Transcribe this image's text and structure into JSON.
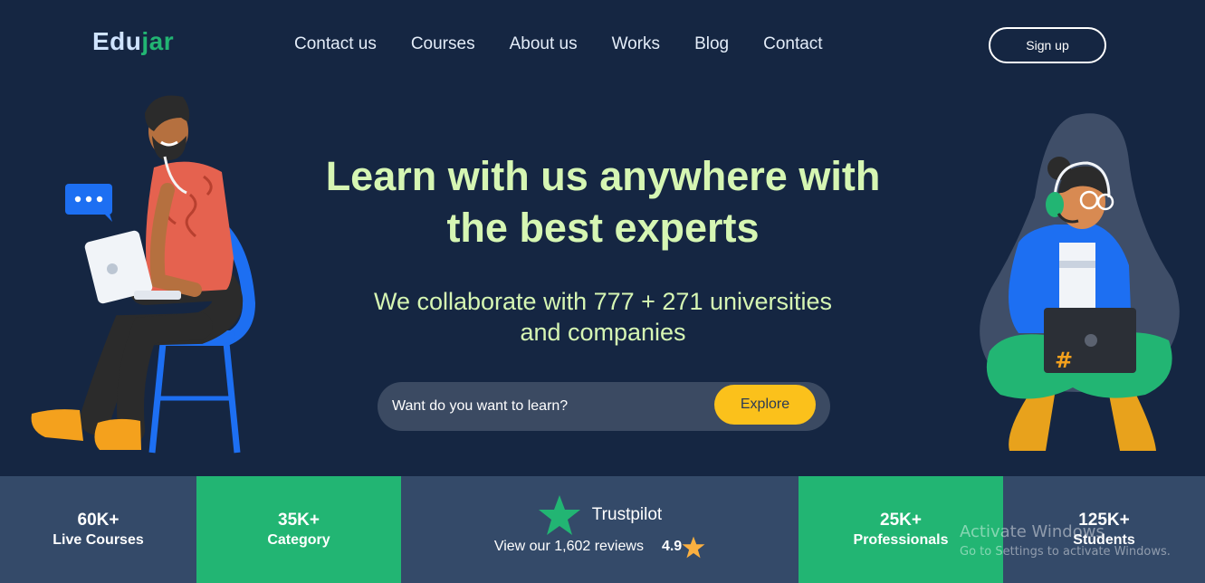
{
  "logo": {
    "part1": "Edu",
    "part2": "jar"
  },
  "nav": [
    {
      "label": "Contact us"
    },
    {
      "label": "Courses"
    },
    {
      "label": "About us"
    },
    {
      "label": "Works"
    },
    {
      "label": "Blog"
    },
    {
      "label": "Contact"
    }
  ],
  "signup_label": "Sign up",
  "hero": {
    "title_line1": "Learn with us anywhere with",
    "title_line2": "the best experts",
    "subtitle_line1": "We collaborate with 777 + 271 universities",
    "subtitle_line2": "and companies",
    "search_placeholder": "Want do you want to learn?",
    "explore_label": "Explore"
  },
  "stats": {
    "live_courses": {
      "num": "60K+",
      "label": "Live Courses"
    },
    "category": {
      "num": "35K+",
      "label": "Category"
    },
    "trustpilot": {
      "name": "Trustpilot",
      "reviews": "View our 1,602 reviews",
      "rating": "4.9"
    },
    "professionals": {
      "num": "25K+",
      "label": "Professionals"
    },
    "students": {
      "num": "125K+",
      "label": "Students"
    }
  },
  "watermark": {
    "line1": "Activate Windows",
    "line2": "Go to Settings to activate Windows."
  },
  "colors": {
    "background": "#152642",
    "accent_green": "#22b573",
    "title_green": "#d6f6b3",
    "explore_yellow": "#fbc11b",
    "stat_blue": "#344a69"
  },
  "icons": [
    "chat-bubble-icon",
    "trustpilot-star-icon",
    "rating-star-icon"
  ]
}
